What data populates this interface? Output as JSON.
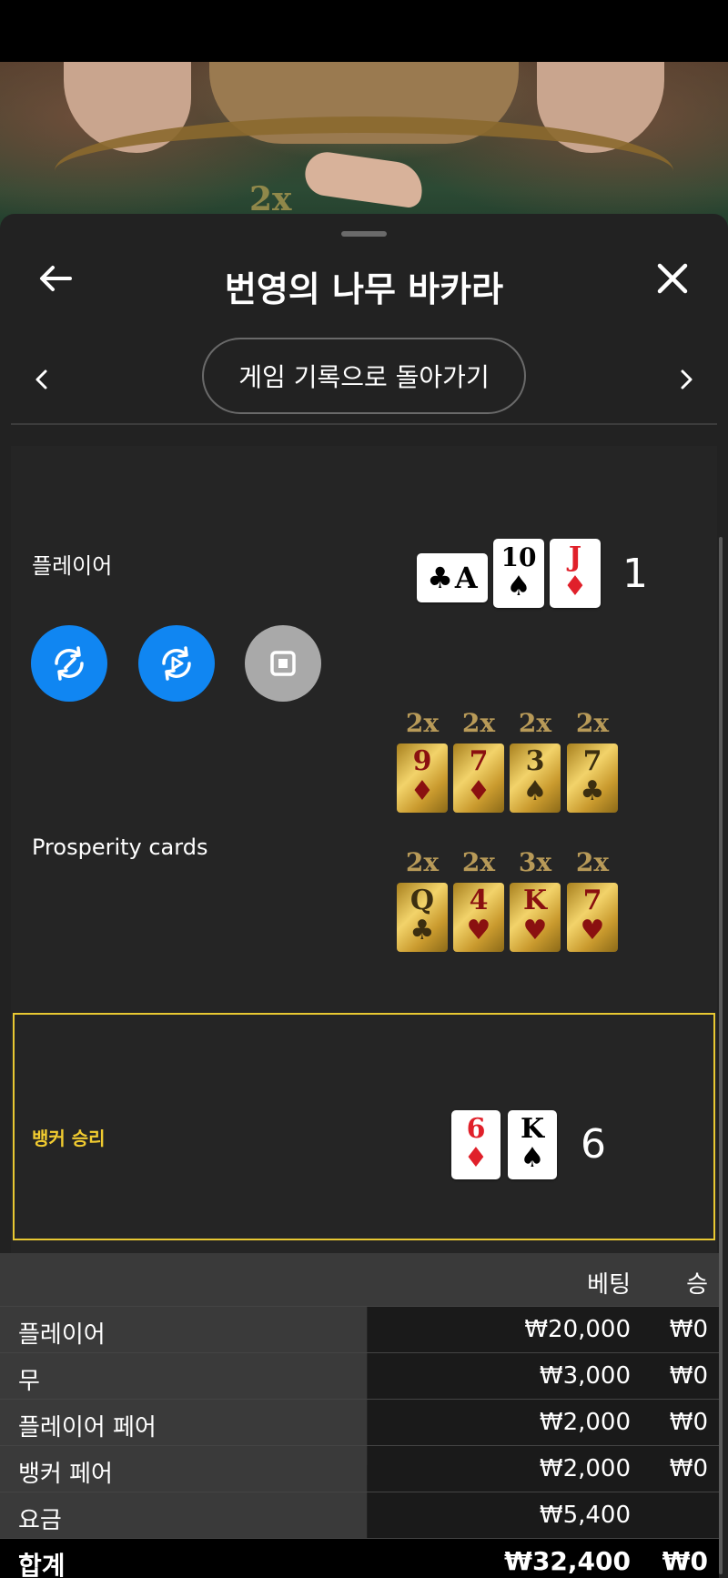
{
  "header": {
    "title": "번영의 나무 바카라"
  },
  "nav": {
    "history_button": "게임 기록으로 돌아가기"
  },
  "video": {
    "felt_multiplier": "2x"
  },
  "player": {
    "label": "플레이어",
    "score": "1",
    "cards": [
      {
        "rank": "A",
        "suit": "♣",
        "color": "black"
      },
      {
        "rank": "10",
        "suit": "♠",
        "color": "black"
      },
      {
        "rank": "J",
        "suit": "♦",
        "color": "red"
      }
    ]
  },
  "controls": [
    "rewind-icon",
    "replay-icon",
    "stop-icon"
  ],
  "prosperity": {
    "label": "Prosperity cards",
    "row1": [
      {
        "mult": "2x",
        "rank": "9",
        "suit": "♦",
        "color": "red"
      },
      {
        "mult": "2x",
        "rank": "7",
        "suit": "♦",
        "color": "red"
      },
      {
        "mult": "2x",
        "rank": "3",
        "suit": "♠",
        "color": "black"
      },
      {
        "mult": "2x",
        "rank": "7",
        "suit": "♣",
        "color": "black"
      }
    ],
    "row2": [
      {
        "mult": "2x",
        "rank": "Q",
        "suit": "♣",
        "color": "black"
      },
      {
        "mult": "2x",
        "rank": "4",
        "suit": "♥",
        "color": "red"
      },
      {
        "mult": "3x",
        "rank": "K",
        "suit": "♥",
        "color": "red"
      },
      {
        "mult": "2x",
        "rank": "7",
        "suit": "♥",
        "color": "red"
      }
    ]
  },
  "banker": {
    "label": "뱅커 승리",
    "score": "6",
    "cards": [
      {
        "rank": "6",
        "suit": "♦",
        "color": "red"
      },
      {
        "rank": "K",
        "suit": "♠",
        "color": "black"
      }
    ]
  },
  "bets": {
    "col_bet": "베팅",
    "col_win": "승",
    "rows": [
      {
        "name": "플레이어",
        "bet": "₩20,000",
        "win": "₩0"
      },
      {
        "name": "무",
        "bet": "₩3,000",
        "win": "₩0"
      },
      {
        "name": "플레이어 페어",
        "bet": "₩2,000",
        "win": "₩0"
      },
      {
        "name": "뱅커 페어",
        "bet": "₩2,000",
        "win": "₩0"
      },
      {
        "name": "요금",
        "bet": "₩5,400",
        "win": ""
      }
    ],
    "total": {
      "name": "합계",
      "bet": "₩32,400",
      "win": "₩0"
    }
  },
  "colors": {
    "accent_blue": "#1086f2",
    "banker_gold": "#f2cc30",
    "panel_bg": "#222222"
  }
}
